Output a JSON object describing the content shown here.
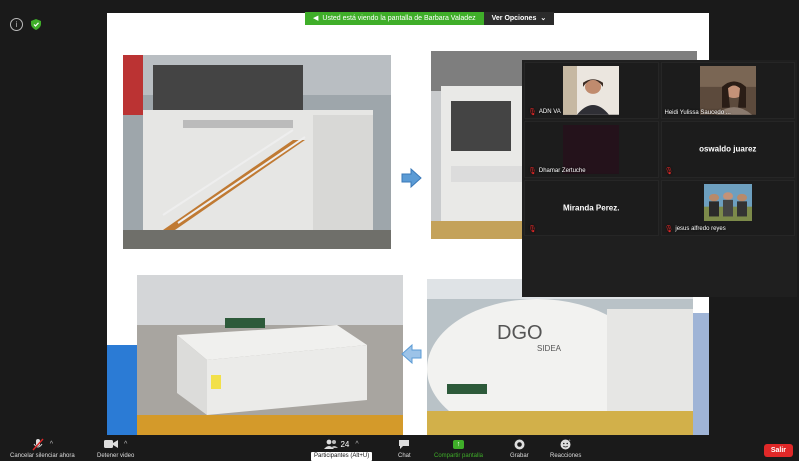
{
  "banner": {
    "message": "Usted está viendo la pantalla de Barbara Valadez",
    "options_label": "Ver Opciones"
  },
  "gallery": {
    "participants": [
      {
        "name": "ADN VA",
        "muted": true,
        "video": true
      },
      {
        "name": "Heidi Yulissa Saucedo ...",
        "muted": false,
        "video": true
      },
      {
        "name": "Dhamar Zertuche",
        "muted": true,
        "video": true
      },
      {
        "name": "oswaldo juarez",
        "muted": true,
        "video": false
      },
      {
        "name": "Miranda Perez.",
        "muted": true,
        "video": false
      },
      {
        "name": "jesus alfredo reyes",
        "muted": true,
        "video": true
      }
    ]
  },
  "toolbar": {
    "mute_label": "Cancelar silenciar ahora",
    "video_label": "Detener video",
    "participants_count": "24",
    "participants_tooltip": "Participantes (Alt+U)",
    "chat_label": "Chat",
    "share_label": "Compartir pantalla",
    "record_label": "Grabar",
    "reactions_label": "Reacciones",
    "leave_label": "Salir"
  },
  "colors": {
    "accent_green": "#3fae29",
    "danger_red": "#e02828",
    "slide_blue": "#2b7bd5"
  },
  "icons": [
    "info-icon",
    "shield-icon",
    "share-screen-icon",
    "chevron-down-icon",
    "microphone-muted-icon",
    "camera-icon",
    "participants-icon",
    "chat-icon",
    "share-arrow-icon",
    "record-icon",
    "reactions-icon",
    "arrow-right-icon",
    "arrow-left-icon"
  ]
}
